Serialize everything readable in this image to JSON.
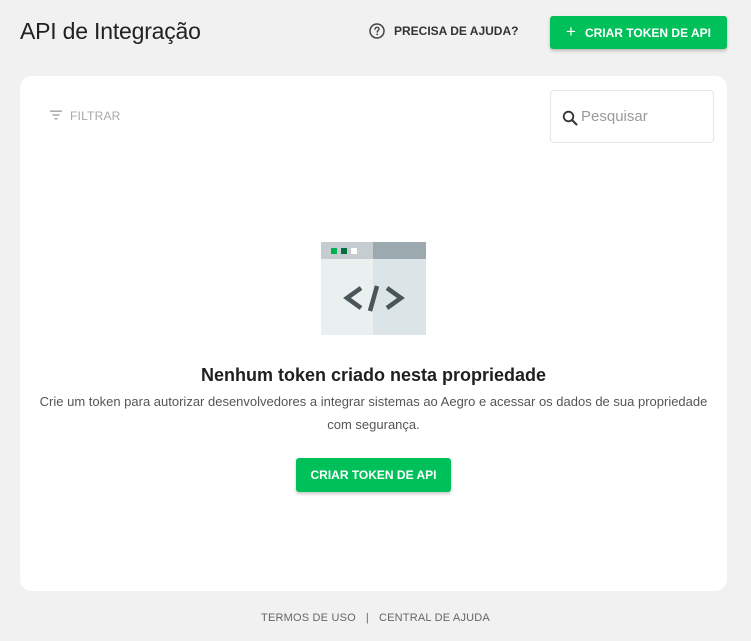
{
  "header": {
    "title": "API de Integração",
    "help_label": "PRECISA DE AJUDA?",
    "help_icon": "question-circle-icon",
    "create_button_label": "CRIAR TOKEN DE API",
    "create_button_icon": "plus-icon"
  },
  "toolbar": {
    "filter_label": "FILTRAR",
    "filter_icon": "filter-lines-icon",
    "search_placeholder": "Pesquisar",
    "search_icon": "search-icon"
  },
  "empty_state": {
    "illustration": "code-window-illustration",
    "title": "Nenhum token criado nesta propriedade",
    "description": "Crie um token para autorizar desenvolvedores a integrar sistemas ao Aegro e acessar os dados de sua propriedade com segurança.",
    "button_label": "CRIAR TOKEN DE API"
  },
  "footer": {
    "terms_label": "TERMOS DE USO",
    "separator": "|",
    "help_center_label": "CENTRAL DE AJUDA"
  },
  "colors": {
    "accent": "#00c05a",
    "background": "#f1f1f1",
    "card": "#ffffff"
  }
}
